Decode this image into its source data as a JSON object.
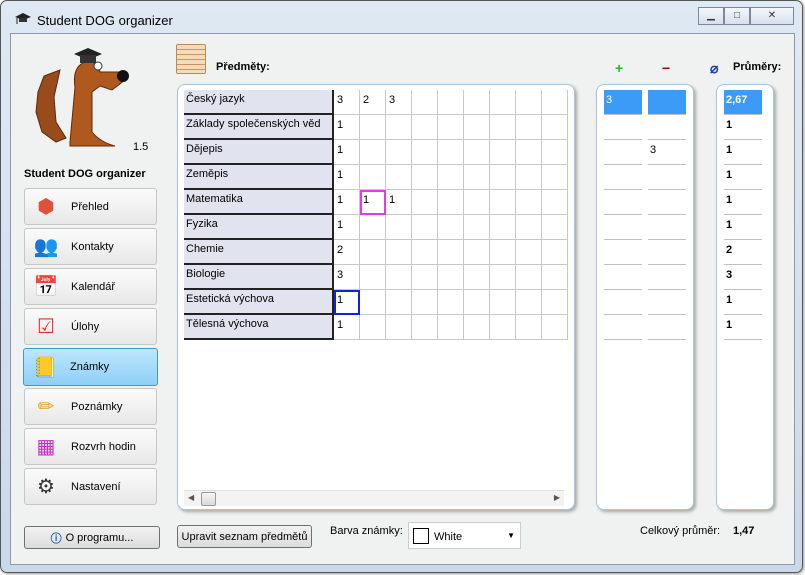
{
  "window": {
    "title": "Student DOG organizer",
    "controls": [
      "minimize",
      "maximize",
      "close"
    ]
  },
  "app": {
    "name": "Student DOG organizer",
    "version": "1.5"
  },
  "nav": [
    {
      "label": "Přehled",
      "icon": "cube-icon"
    },
    {
      "label": "Kontakty",
      "icon": "contacts-icon"
    },
    {
      "label": "Kalendář",
      "icon": "calendar-icon"
    },
    {
      "label": "Úlohy",
      "icon": "tasks-icon"
    },
    {
      "label": "Známky",
      "icon": "notebook-icon",
      "selected": true
    },
    {
      "label": "Poznámky",
      "icon": "pencil-icon"
    },
    {
      "label": "Rozvrh hodin",
      "icon": "timetable-icon"
    },
    {
      "label": "Nastavení",
      "icon": "gear-icon"
    }
  ],
  "about_button": "O programu...",
  "section": {
    "title": "Předměty:"
  },
  "subjects": [
    {
      "name": "Český jazyk",
      "grades": [
        "3",
        "2",
        "3"
      ],
      "plus": "3",
      "minus": "",
      "avg": "2,67"
    },
    {
      "name": "Základy společenských věd",
      "grades": [
        "1"
      ],
      "plus": "",
      "minus": "",
      "avg": "1"
    },
    {
      "name": "Dějepis",
      "grades": [
        "1"
      ],
      "plus": "",
      "minus": "3",
      "avg": "1"
    },
    {
      "name": "Zeměpis",
      "grades": [
        "1"
      ],
      "plus": "",
      "minus": "",
      "avg": "1"
    },
    {
      "name": "Matematika",
      "grades": [
        "1",
        "1",
        "1"
      ],
      "plus": "",
      "minus": "",
      "avg": "1"
    },
    {
      "name": "Fyzika",
      "grades": [
        "1"
      ],
      "plus": "",
      "minus": "",
      "avg": "1"
    },
    {
      "name": "Chemie",
      "grades": [
        "2"
      ],
      "plus": "",
      "minus": "",
      "avg": "2"
    },
    {
      "name": "Biologie",
      "grades": [
        "3"
      ],
      "plus": "",
      "minus": "",
      "avg": "3"
    },
    {
      "name": "Estetická výchova",
      "grades": [
        "1"
      ],
      "plus": "",
      "minus": "",
      "avg": "1"
    },
    {
      "name": "Tělesná výchova",
      "grades": [
        "1"
      ],
      "plus": "",
      "minus": "",
      "avg": "1"
    }
  ],
  "headers": {
    "plus": "+",
    "minus": "−",
    "avg_symbol": "⌀",
    "averages": "Průměry:"
  },
  "colors": {
    "plus": "#22bb22",
    "minus": "#aa0000",
    "selected_row": "#3d9bf8",
    "selected_nav": "#9ad5f8"
  },
  "edit_button": "Upravit seznam předmětů",
  "grade_color": {
    "label": "Barva známky:",
    "value": "White"
  },
  "overall": {
    "label": "Celkový průměr:",
    "value": "1,47"
  }
}
